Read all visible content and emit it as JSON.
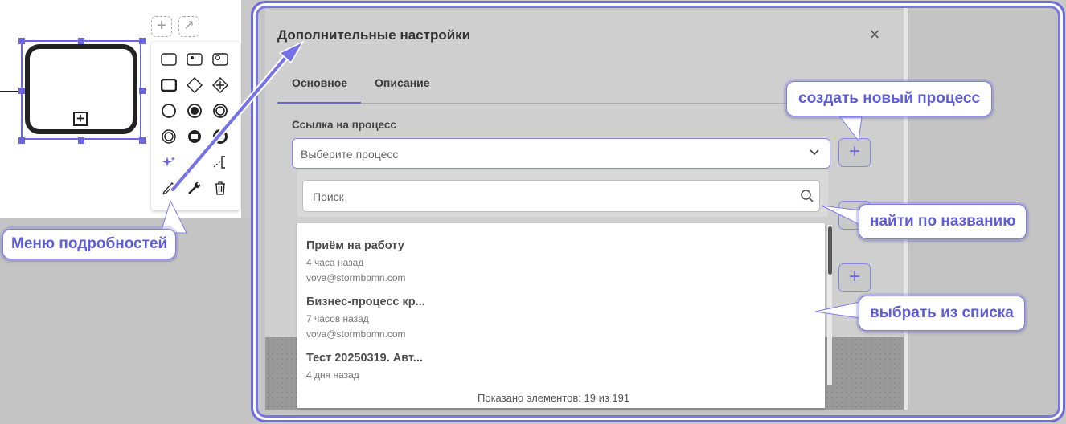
{
  "modal": {
    "title": "Дополнительные настройки",
    "close_symbol": "×",
    "tabs": [
      {
        "label": "Основное",
        "active": true
      },
      {
        "label": "Описание",
        "active": false
      }
    ],
    "field_label": "Ссылка на процесс",
    "select_placeholder": "Выберите процесс",
    "search_placeholder": "Поиск",
    "items": [
      {
        "title": "Приём на работу",
        "time": "4 часа назад",
        "author": "vova@stormbpmn.com"
      },
      {
        "title": "Бизнес-процесс кр...",
        "time": "7 часов назад",
        "author": "vova@stormbpmn.com"
      },
      {
        "title": "Тест 20250319. Авт...",
        "time": "4 дня назад",
        "author": ""
      }
    ],
    "list_footer": "Показано элементов: 19 из 191",
    "plus_symbol": "+"
  },
  "callouts": {
    "details_menu": "Меню подробностей",
    "create_process": "создать новый процесс",
    "find_by_name": "найти по названию",
    "choose_from_list": "выбрать из списка"
  },
  "palette_icons": [
    "task-icon",
    "user-task-icon",
    "service-task-icon",
    "subprocess-icon",
    "gateway-icon",
    "parallel-gateway-icon",
    "start-event-icon",
    "message-catch-event-icon",
    "message-boundary-event-icon",
    "intermediate-event-icon",
    "message-throw-event-icon",
    "end-event-icon",
    "sparkle-icon",
    "connect-icon",
    "annotation-icon",
    "pencil-icon",
    "wrench-icon",
    "trash-icon"
  ],
  "colors": {
    "accent": "#6866cc",
    "callout_text": "#5f5cd8",
    "arrow": "#7572e8"
  }
}
